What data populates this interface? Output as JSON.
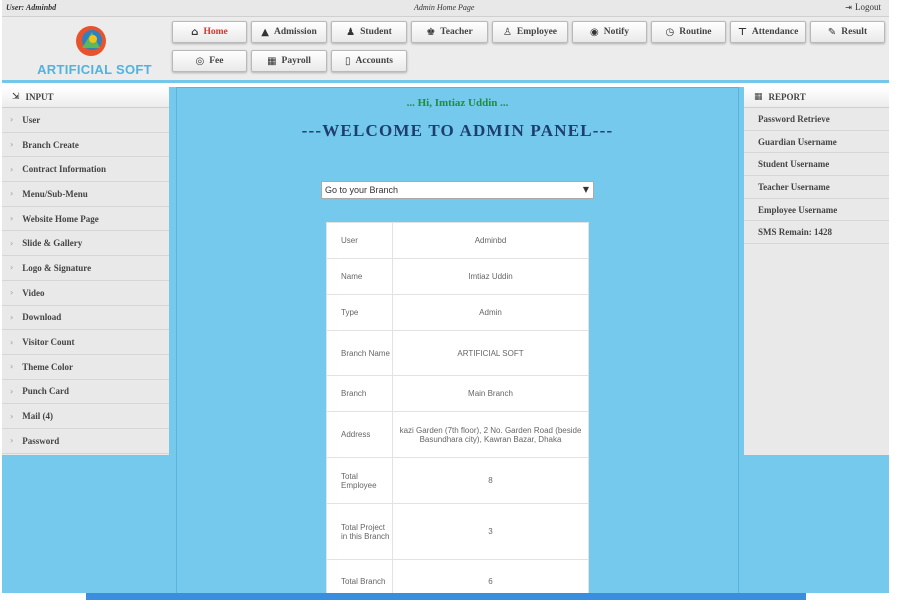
{
  "topbar": {
    "user": "User: Adminbd",
    "page_title": "Admin Home Page",
    "logout": "Logout"
  },
  "brand": {
    "name": "ARTIFICIAL SOFT",
    "accent_color": "#4fb3e0"
  },
  "nav": {
    "row1": [
      {
        "label": "Home",
        "icon": "home-icon",
        "active": true
      },
      {
        "label": "Admission",
        "icon": "graduation-cap-icon"
      },
      {
        "label": "Student",
        "icon": "users-icon"
      },
      {
        "label": "Teacher",
        "icon": "teacher-icon"
      },
      {
        "label": "Employee",
        "icon": "employee-icon"
      },
      {
        "label": "Notify",
        "icon": "eye-icon"
      },
      {
        "label": "Routine",
        "icon": "clock-icon"
      },
      {
        "label": "Attendance",
        "icon": "thumbtack-icon"
      },
      {
        "label": "Result",
        "icon": "pencil-icon"
      }
    ],
    "row2": [
      {
        "label": "Fee",
        "icon": "money-icon"
      },
      {
        "label": "Payroll",
        "icon": "calendar-icon"
      },
      {
        "label": "Accounts",
        "icon": "document-icon"
      }
    ]
  },
  "sidebar": {
    "title": "INPUT",
    "items": [
      "User",
      "Branch Create",
      "Contract Information",
      "Menu/Sub-Menu",
      "Website Home Page",
      "Slide & Gallery",
      "Logo & Signature",
      "Video",
      "Download",
      "Visitor Count",
      "Theme Color",
      "Punch Card",
      "Mail (4)",
      "Password"
    ]
  },
  "report": {
    "title": "REPORT",
    "items": [
      "Password Retrieve",
      "Guardian Username",
      "Student Username",
      "Teacher Username",
      "Employee Username",
      "SMS Remain: 1428"
    ]
  },
  "main": {
    "greeting": "... Hi, Imtiaz Uddin ...",
    "welcome": "---WELCOME TO ADMIN PANEL---",
    "branch_select": "Go to your Branch",
    "background_color": "#74c9ec",
    "info": [
      {
        "key": "User",
        "value": "Adminbd"
      },
      {
        "key": "Name",
        "value": "Imtiaz Uddin"
      },
      {
        "key": "Type",
        "value": "Admin"
      },
      {
        "key": "Branch Name",
        "value": "ARTIFICIAL SOFT"
      },
      {
        "key": "Branch",
        "value": "Main Branch"
      },
      {
        "key": "Address",
        "value": "kazi Garden (7th floor), 2 No. Garden Road (beside Basundhara city), Kawran Bazar, Dhaka"
      },
      {
        "key": "Total Employee",
        "value": "8"
      },
      {
        "key": "Total Project in this Branch",
        "value": "3"
      },
      {
        "key": "Total Branch",
        "value": "6"
      }
    ]
  }
}
